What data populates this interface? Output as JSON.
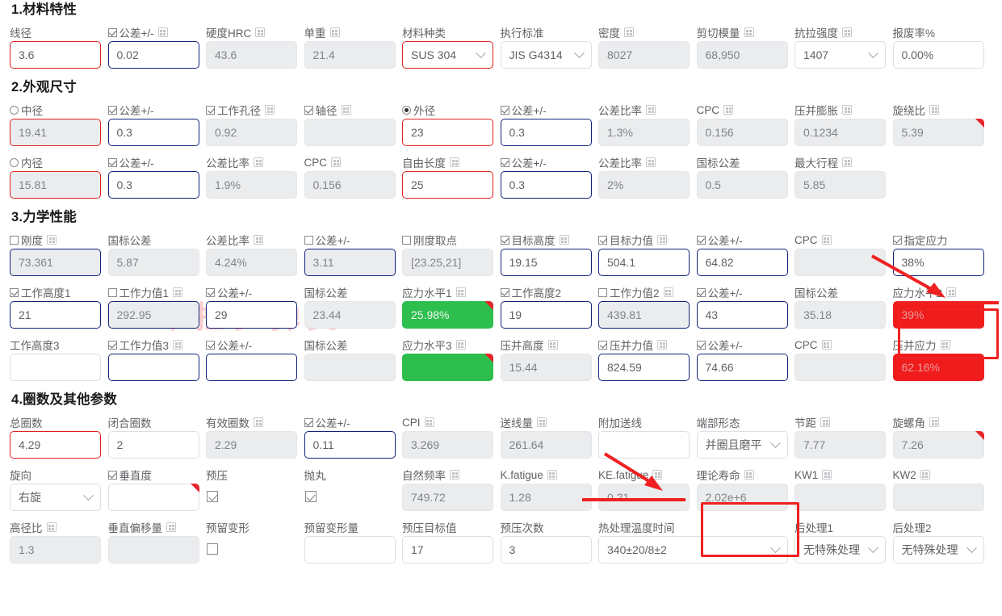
{
  "watermark": "卡捡罗弹簧",
  "sections": [
    {
      "title": "1.材料特性",
      "rows": [
        [
          {
            "label": "线径",
            "mark": "none",
            "icon": false,
            "value": "3.6",
            "style": "red"
          },
          {
            "label": "公差+/-",
            "mark": "checked",
            "icon": true,
            "value": "0.02",
            "style": "blue"
          },
          {
            "label": "硬度HRC",
            "mark": "none",
            "icon": true,
            "value": "43.6",
            "style": "ro"
          },
          {
            "label": "单重",
            "mark": "none",
            "icon": true,
            "value": "21.4",
            "style": "ro"
          },
          {
            "label": "材料种类",
            "mark": "none",
            "icon": false,
            "value": "SUS 304",
            "style": "red",
            "select": true
          },
          {
            "label": "执行标准",
            "mark": "none",
            "icon": false,
            "value": "JIS G4314",
            "style": "plain",
            "select": true
          },
          {
            "label": "密度",
            "mark": "none",
            "icon": true,
            "value": "8027",
            "style": "ro"
          },
          {
            "label": "剪切模量",
            "mark": "none",
            "icon": true,
            "value": "68,950",
            "style": "ro"
          },
          {
            "label": "抗拉强度",
            "mark": "none",
            "icon": true,
            "value": "1407",
            "style": "plain",
            "select": true
          },
          {
            "label": "报废率%",
            "mark": "none",
            "icon": false,
            "value": "0.00%",
            "style": "plain"
          }
        ]
      ]
    },
    {
      "title": "2.外观尺寸",
      "rows": [
        [
          {
            "label": "中径",
            "mark": "radio-off",
            "icon": false,
            "value": "19.41",
            "style": "ro-red"
          },
          {
            "label": "公差+/-",
            "mark": "checked",
            "icon": false,
            "value": "0.3",
            "style": "blue"
          },
          {
            "label": "工作孔径",
            "mark": "checked",
            "icon": true,
            "value": "0.92",
            "style": "ro"
          },
          {
            "label": "轴径",
            "mark": "checked",
            "icon": true,
            "value": "",
            "style": "ro"
          },
          {
            "label": "外径",
            "mark": "radio-on",
            "icon": false,
            "value": "23",
            "style": "red"
          },
          {
            "label": "公差+/-",
            "mark": "checked",
            "icon": false,
            "value": "0.3",
            "style": "blue"
          },
          {
            "label": "公差比率",
            "mark": "none",
            "icon": true,
            "value": "1.3%",
            "style": "ro"
          },
          {
            "label": "CPC",
            "mark": "none",
            "icon": true,
            "value": "0.156",
            "style": "ro"
          },
          {
            "label": "压并膨胀",
            "mark": "none",
            "icon": true,
            "value": "0.1234",
            "style": "ro"
          },
          {
            "label": "旋绕比",
            "mark": "none",
            "icon": true,
            "value": "5.39",
            "style": "ro",
            "corner": true
          }
        ],
        [
          {
            "label": "内径",
            "mark": "radio-off",
            "icon": false,
            "value": "15.81",
            "style": "ro-red"
          },
          {
            "label": "公差+/-",
            "mark": "checked",
            "icon": false,
            "value": "0.3",
            "style": "blue"
          },
          {
            "label": "公差比率",
            "mark": "none",
            "icon": true,
            "value": "1.9%",
            "style": "ro"
          },
          {
            "label": "CPC",
            "mark": "none",
            "icon": true,
            "value": "0.156",
            "style": "ro"
          },
          {
            "label": "自由长度",
            "mark": "none",
            "icon": true,
            "value": "25",
            "style": "red"
          },
          {
            "label": "公差+/-",
            "mark": "checked",
            "icon": false,
            "value": "0.3",
            "style": "blue"
          },
          {
            "label": "公差比率",
            "mark": "none",
            "icon": true,
            "value": "2%",
            "style": "ro"
          },
          {
            "label": "国标公差",
            "mark": "none",
            "icon": false,
            "value": "0.5",
            "style": "ro"
          },
          {
            "label": "最大行程",
            "mark": "none",
            "icon": true,
            "value": "5.85",
            "style": "ro"
          }
        ]
      ]
    },
    {
      "title": "3.力学性能",
      "rows": [
        [
          {
            "label": "刚度",
            "mark": "unchecked",
            "icon": true,
            "value": "73.361",
            "style": "blue-ro"
          },
          {
            "label": "国标公差",
            "mark": "none",
            "icon": false,
            "value": "5.87",
            "style": "ro"
          },
          {
            "label": "公差比率",
            "mark": "none",
            "icon": true,
            "value": "4.24%",
            "style": "ro"
          },
          {
            "label": "公差+/-",
            "mark": "unchecked",
            "icon": false,
            "value": "3.11",
            "style": "blue-ro"
          },
          {
            "label": "刚度取点",
            "mark": "unchecked",
            "icon": false,
            "value": "[23.25,21]",
            "style": "ro"
          },
          {
            "label": "目标高度",
            "mark": "checked",
            "icon": true,
            "value": "19.15",
            "style": "blue"
          },
          {
            "label": "目标力值",
            "mark": "checked",
            "icon": true,
            "value": "504.1",
            "style": "blue"
          },
          {
            "label": "公差+/-",
            "mark": "checked",
            "icon": false,
            "value": "64.82",
            "style": "blue"
          },
          {
            "label": "CPC",
            "mark": "none",
            "icon": true,
            "value": "",
            "style": "ro"
          },
          {
            "label": "指定应力",
            "mark": "checked",
            "icon": false,
            "value": "38%",
            "style": "blue"
          }
        ],
        [
          {
            "label": "工作高度1",
            "mark": "checked",
            "icon": false,
            "value": "21",
            "style": "blue"
          },
          {
            "label": "工作力值1",
            "mark": "unchecked",
            "icon": true,
            "value": "292.95",
            "style": "blue-ro"
          },
          {
            "label": "公差+/-",
            "mark": "checked",
            "icon": false,
            "value": "29",
            "style": "blue"
          },
          {
            "label": "国标公差",
            "mark": "none",
            "icon": false,
            "value": "23.44",
            "style": "ro"
          },
          {
            "label": "应力水平1",
            "mark": "none",
            "icon": true,
            "value": "25.98%",
            "style": "green",
            "corner": true
          },
          {
            "label": "工作高度2",
            "mark": "checked",
            "icon": false,
            "value": "19",
            "style": "blue"
          },
          {
            "label": "工作力值2",
            "mark": "unchecked",
            "icon": true,
            "value": "439.81",
            "style": "blue-ro"
          },
          {
            "label": "公差+/-",
            "mark": "checked",
            "icon": false,
            "value": "43",
            "style": "blue"
          },
          {
            "label": "国标公差",
            "mark": "none",
            "icon": false,
            "value": "35.18",
            "style": "ro"
          },
          {
            "label": "应力水平2",
            "mark": "none",
            "icon": true,
            "value": "39%",
            "style": "redfill",
            "corner": true
          }
        ],
        [
          {
            "label": "工作高度3",
            "mark": "none",
            "icon": false,
            "value": "",
            "style": "plain"
          },
          {
            "label": "工作力值3",
            "mark": "checked",
            "icon": true,
            "value": "",
            "style": "blue"
          },
          {
            "label": "公差+/-",
            "mark": "checked",
            "icon": false,
            "value": "",
            "style": "blue"
          },
          {
            "label": "国标公差",
            "mark": "none",
            "icon": false,
            "value": "",
            "style": "ro"
          },
          {
            "label": "应力水平3",
            "mark": "none",
            "icon": true,
            "value": "",
            "style": "green",
            "corner": true
          },
          {
            "label": "压并高度",
            "mark": "none",
            "icon": true,
            "value": "15.44",
            "style": "ro"
          },
          {
            "label": "压并力值",
            "mark": "checked",
            "icon": true,
            "value": "824.59",
            "style": "blue"
          },
          {
            "label": "公差+/-",
            "mark": "checked",
            "icon": false,
            "value": "74.66",
            "style": "blue"
          },
          {
            "label": "CPC",
            "mark": "none",
            "icon": true,
            "value": "",
            "style": "ro"
          },
          {
            "label": "压并应力",
            "mark": "none",
            "icon": true,
            "value": "62.16%",
            "style": "redfill"
          }
        ]
      ]
    },
    {
      "title": "4.圈数及其他参数",
      "rows": [
        [
          {
            "label": "总圈数",
            "mark": "none",
            "icon": false,
            "value": "4.29",
            "style": "red"
          },
          {
            "label": "闭合圈数",
            "mark": "none",
            "icon": false,
            "value": "2",
            "style": "plain"
          },
          {
            "label": "有效圈数",
            "mark": "none",
            "icon": true,
            "value": "2.29",
            "style": "ro"
          },
          {
            "label": "公差+/-",
            "mark": "checked",
            "icon": false,
            "value": "0.11",
            "style": "blue"
          },
          {
            "label": "CPI",
            "mark": "none",
            "icon": true,
            "value": "3.269",
            "style": "ro"
          },
          {
            "label": "送线量",
            "mark": "none",
            "icon": true,
            "value": "261.64",
            "style": "ro"
          },
          {
            "label": "附加送线",
            "mark": "none",
            "icon": false,
            "value": "",
            "style": "plain"
          },
          {
            "label": "端部形态",
            "mark": "none",
            "icon": false,
            "value": "并圈且磨平",
            "style": "plain",
            "select": true
          },
          {
            "label": "节距",
            "mark": "none",
            "icon": true,
            "value": "7.77",
            "style": "ro"
          },
          {
            "label": "旋螺角",
            "mark": "none",
            "icon": true,
            "value": "7.26",
            "style": "ro",
            "corner": true
          }
        ],
        [
          {
            "label": "旋向",
            "mark": "none",
            "icon": false,
            "value": "右旋",
            "style": "plain",
            "select": true
          },
          {
            "label": "垂直度",
            "mark": "checked",
            "icon": false,
            "value": "",
            "style": "plain",
            "corner": true
          },
          {
            "label": "预压",
            "mark": "none",
            "icon": false,
            "value": "",
            "style": "solo-checkbox-checked"
          },
          {
            "label": "抛丸",
            "mark": "none",
            "icon": false,
            "value": "",
            "style": "solo-checkbox-checked"
          },
          {
            "label": "自然频率",
            "mark": "none",
            "icon": true,
            "value": "749.72",
            "style": "ro"
          },
          {
            "label": "K.fatigue",
            "mark": "none",
            "icon": true,
            "value": "1.28",
            "style": "ro"
          },
          {
            "label": "KE.fatigue",
            "mark": "none",
            "icon": true,
            "value": "0.21",
            "style": "ro"
          },
          {
            "label": "理论寿命",
            "mark": "none",
            "icon": true,
            "value": "2.02e+6",
            "style": "ro"
          },
          {
            "label": "KW1",
            "mark": "none",
            "icon": true,
            "value": "",
            "style": "ro"
          },
          {
            "label": "KW2",
            "mark": "none",
            "icon": true,
            "value": "",
            "style": "ro"
          }
        ],
        [
          {
            "label": "高径比",
            "mark": "none",
            "icon": true,
            "value": "1.3",
            "style": "ro"
          },
          {
            "label": "垂直偏移量",
            "mark": "none",
            "icon": true,
            "value": "",
            "style": "ro"
          },
          {
            "label": "预留变形",
            "mark": "none",
            "icon": false,
            "value": "",
            "style": "solo-checkbox"
          },
          {
            "label": "预留变形量",
            "mark": "none",
            "icon": false,
            "value": "",
            "style": "plain"
          },
          {
            "label": "预压目标值",
            "mark": "none",
            "icon": false,
            "value": "17",
            "style": "plain"
          },
          {
            "label": "预压次数",
            "mark": "none",
            "icon": false,
            "value": "3",
            "style": "plain"
          },
          {
            "label": "热处理温度时间",
            "mark": "none",
            "icon": false,
            "value": "340±20/8±2",
            "style": "plain",
            "select": true,
            "wide": true
          },
          {
            "label": "后处理1",
            "mark": "none",
            "icon": false,
            "value": "无特殊处理",
            "style": "plain",
            "select": true
          },
          {
            "label": "后处理2",
            "mark": "none",
            "icon": false,
            "value": "无特殊处理",
            "style": "plain",
            "select": true
          }
        ]
      ]
    }
  ],
  "annotations": {
    "arrow_stress": "red-arrow-pointing-to-specified-stress",
    "box_stress_level_2": "red-box-around-stress-level-2",
    "arrow_end_form": "red-arrow-pointing-to-end-form",
    "box_theoretical_life": "red-box-around-theoretical-life"
  }
}
